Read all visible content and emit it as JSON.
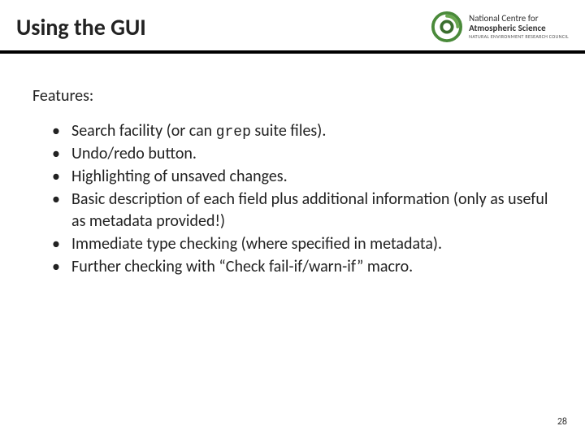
{
  "header": {
    "title": "Using the GUI",
    "logo": {
      "line1": "National Centre for",
      "line2": "Atmospheric Science",
      "line3": "NATURAL ENVIRONMENT RESEARCH COUNCIL"
    }
  },
  "content": {
    "features_heading": "Features:",
    "bullets": {
      "b1_pre": "Search facility (or can ",
      "b1_code": "grep",
      "b1_post": " suite files).",
      "b2": "Undo/redo button.",
      "b3": "Highlighting of unsaved changes.",
      "b4": "Basic description of each field plus additional information (only as useful as metadata provided!)",
      "b5": "Immediate type checking (where specified in metadata).",
      "b6": "Further checking with “Check fail-if/warn-if” macro."
    }
  },
  "page_number": "28"
}
